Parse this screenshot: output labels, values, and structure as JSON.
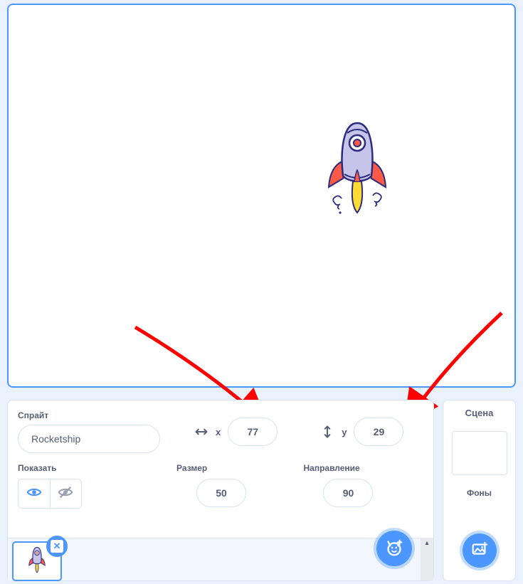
{
  "spritePanel": {
    "spriteSectionLabel": "Спрайт",
    "spriteName": "Rocketship",
    "xLabel": "x",
    "xValue": "77",
    "yLabel": "y",
    "yValue": "29",
    "showSectionLabel": "Показать",
    "sizeSectionLabel": "Размер",
    "sizeValue": "50",
    "directionSectionLabel": "Направление",
    "directionValue": "90",
    "deleteGlyph": "✕"
  },
  "stagePanel": {
    "title": "Сцена",
    "backdropsLabel": "Фоны"
  },
  "colors": {
    "accent": "#4c97ff",
    "text": "#575e75",
    "arrow": "#ff0000"
  }
}
